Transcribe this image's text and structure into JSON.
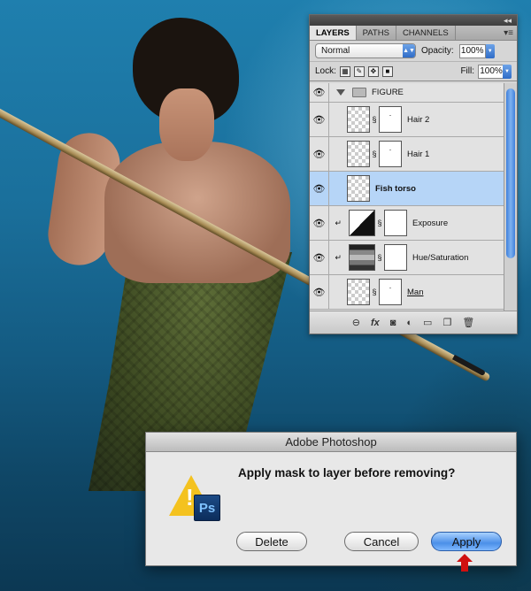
{
  "layers_panel": {
    "tabs": [
      "LAYERS",
      "PATHS",
      "CHANNELS"
    ],
    "blend_mode": "Normal",
    "opacity_label": "Opacity:",
    "opacity_value": "100%",
    "lock_label": "Lock:",
    "fill_label": "Fill:",
    "fill_value": "100%",
    "layers": [
      {
        "name": "FIGURE",
        "kind": "group"
      },
      {
        "name": "Hair 2",
        "kind": "layer"
      },
      {
        "name": "Hair 1",
        "kind": "layer"
      },
      {
        "name": "Fish torso",
        "kind": "layer",
        "selected": true
      },
      {
        "name": "Exposure",
        "kind": "adjustment"
      },
      {
        "name": "Hue/Saturation",
        "kind": "adjustment"
      },
      {
        "name": "Man",
        "kind": "layer"
      }
    ],
    "bottom_icons": [
      "link-layers-icon",
      "fx-icon",
      "add-mask-icon",
      "adjustment-icon",
      "new-group-icon",
      "new-layer-icon",
      "trash-icon"
    ]
  },
  "dialog": {
    "title": "Adobe Photoshop",
    "message": "Apply mask to layer before removing?",
    "icon_text": "Ps",
    "buttons": {
      "delete": "Delete",
      "cancel": "Cancel",
      "apply": "Apply"
    }
  },
  "colors": {
    "accent": "#4b8fe8",
    "selection": "#b6d5f7",
    "arrow": "#d01010"
  }
}
